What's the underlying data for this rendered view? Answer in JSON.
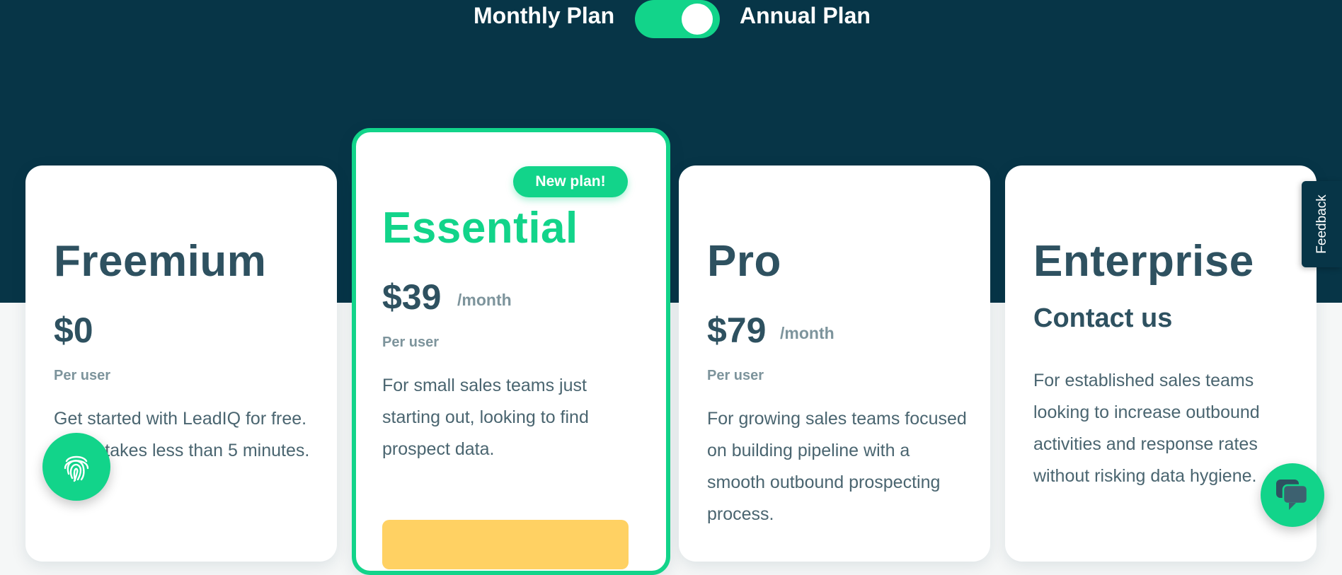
{
  "billing_toggle": {
    "monthly_label": "Monthly Plan",
    "annual_label": "Annual Plan",
    "annual_selected": true
  },
  "plans": [
    {
      "name": "Freemium",
      "price": "$0",
      "per_user": "Per user",
      "description": "Get started with LeadIQ for free. Setup takes less than 5 minutes."
    },
    {
      "name": "Essential",
      "badge": "New plan!",
      "price": "$39",
      "period": "/month",
      "per_user": "Per user",
      "description": "For small sales teams just starting out, looking to find prospect data."
    },
    {
      "name": "Pro",
      "price": "$79",
      "period": "/month",
      "per_user": "Per user",
      "description": "For growing sales teams focused on building pipeline with a smooth outbound prospecting process."
    },
    {
      "name": "Enterprise",
      "contact": "Contact us",
      "description": "For established sales teams looking to increase outbound activities and response rates without risking data hygiene."
    }
  ],
  "feedback_tab": {
    "label": "Feedback"
  },
  "colors": {
    "hero_bg": "#073547",
    "accent": "#12d48a",
    "cta": "#ffd163",
    "text": "#2e5160"
  },
  "icons": {
    "fingerprint_button": "fingerprint-icon",
    "chat_button": "chat-bubble-icon"
  }
}
